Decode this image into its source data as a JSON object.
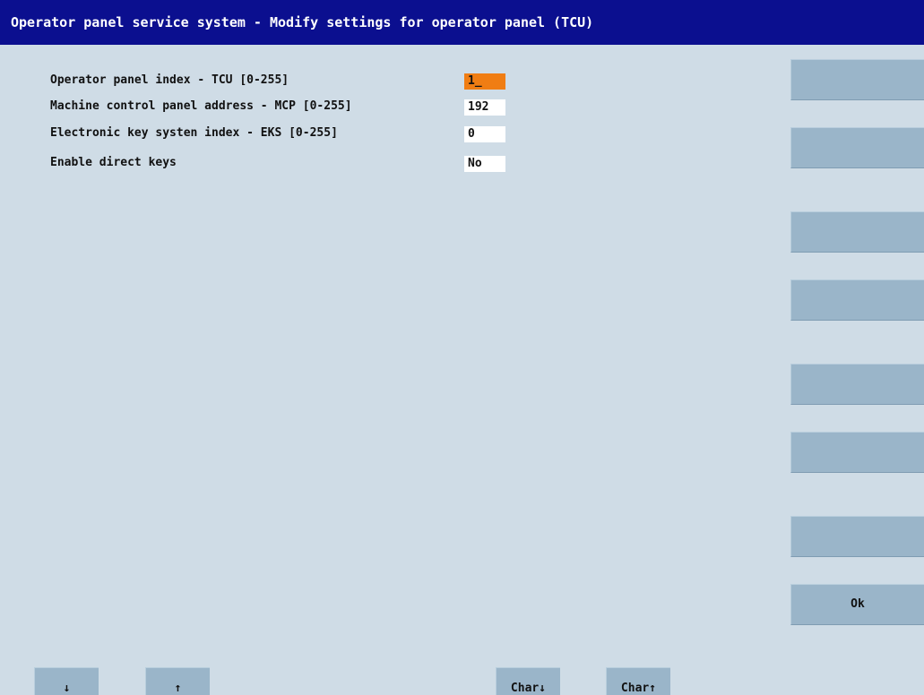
{
  "header": {
    "title": "Operator panel service system - Modify settings for operator panel (TCU)"
  },
  "fields": [
    {
      "label": "Operator panel index - TCU [0-255]",
      "value": "1_"
    },
    {
      "label": "Machine control panel address - MCP [0-255]",
      "value": "192"
    },
    {
      "label": "Electronic key systen index - EKS [0-255]",
      "value": "0"
    },
    {
      "label": "Enable direct keys",
      "value": "No"
    }
  ],
  "softkeys": {
    "vertical": [
      "",
      "",
      "",
      "",
      "",
      "",
      "",
      "Ok"
    ],
    "horizontal": {
      "down_label": "↓",
      "up_label": "↑",
      "char_down_label": "Char↓",
      "char_up_label": "Char↑"
    }
  },
  "colors": {
    "title_bar": "#0b0f8f",
    "background": "#cfdce6",
    "softkey": "#9ab5c9",
    "active_field": "#f07d13",
    "field": "#ffffff"
  }
}
